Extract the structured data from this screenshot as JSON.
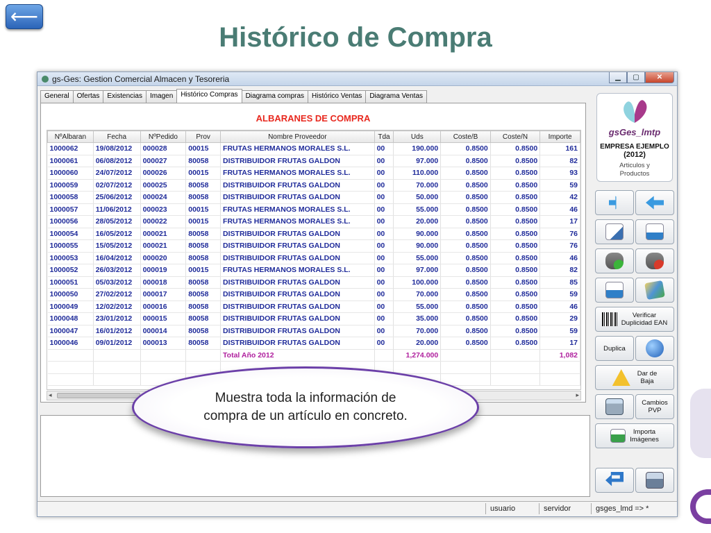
{
  "slide": {
    "title": "Histórico de Compra",
    "back_label": "⟵"
  },
  "window": {
    "title": "gs-Ges: Gestion Comercial Almacen y Tesoreria"
  },
  "tabs": [
    "General",
    "Ofertas",
    "Existencias",
    "Imagen",
    "Histórico Compras",
    "Diagrama compras",
    "Histórico Ventas",
    "Diagrama Ventas"
  ],
  "grid": {
    "title": "ALBARANES DE COMPRA",
    "columns": [
      "NºAlbaran",
      "Fecha",
      "NºPedido",
      "Prov",
      "Nombre Proveedor",
      "Tda",
      "Uds",
      "Coste/B",
      "Coste/N",
      "Importe"
    ],
    "rows": [
      [
        "1000062",
        "19/08/2012",
        "000028",
        "00015",
        "FRUTAS HERMANOS MORALES S.L.",
        "00",
        "190.000",
        "0.8500",
        "0.8500",
        "161"
      ],
      [
        "1000061",
        "06/08/2012",
        "000027",
        "80058",
        "DISTRIBUIDOR FRUTAS GALDON",
        "00",
        "97.000",
        "0.8500",
        "0.8500",
        "82"
      ],
      [
        "1000060",
        "24/07/2012",
        "000026",
        "00015",
        "FRUTAS HERMANOS MORALES S.L.",
        "00",
        "110.000",
        "0.8500",
        "0.8500",
        "93"
      ],
      [
        "1000059",
        "02/07/2012",
        "000025",
        "80058",
        "DISTRIBUIDOR FRUTAS GALDON",
        "00",
        "70.000",
        "0.8500",
        "0.8500",
        "59"
      ],
      [
        "1000058",
        "25/06/2012",
        "000024",
        "80058",
        "DISTRIBUIDOR FRUTAS GALDON",
        "00",
        "50.000",
        "0.8500",
        "0.8500",
        "42"
      ],
      [
        "1000057",
        "11/06/2012",
        "000023",
        "00015",
        "FRUTAS HERMANOS MORALES S.L.",
        "00",
        "55.000",
        "0.8500",
        "0.8500",
        "46"
      ],
      [
        "1000056",
        "28/05/2012",
        "000022",
        "00015",
        "FRUTAS HERMANOS MORALES S.L.",
        "00",
        "20.000",
        "0.8500",
        "0.8500",
        "17"
      ],
      [
        "1000054",
        "16/05/2012",
        "000021",
        "80058",
        "DISTRIBUIDOR FRUTAS GALDON",
        "00",
        "90.000",
        "0.8500",
        "0.8500",
        "76"
      ],
      [
        "1000055",
        "15/05/2012",
        "000021",
        "80058",
        "DISTRIBUIDOR FRUTAS GALDON",
        "00",
        "90.000",
        "0.8500",
        "0.8500",
        "76"
      ],
      [
        "1000053",
        "16/04/2012",
        "000020",
        "80058",
        "DISTRIBUIDOR FRUTAS GALDON",
        "00",
        "55.000",
        "0.8500",
        "0.8500",
        "46"
      ],
      [
        "1000052",
        "26/03/2012",
        "000019",
        "00015",
        "FRUTAS HERMANOS MORALES S.L.",
        "00",
        "97.000",
        "0.8500",
        "0.8500",
        "82"
      ],
      [
        "1000051",
        "05/03/2012",
        "000018",
        "80058",
        "DISTRIBUIDOR FRUTAS GALDON",
        "00",
        "100.000",
        "0.8500",
        "0.8500",
        "85"
      ],
      [
        "1000050",
        "27/02/2012",
        "000017",
        "80058",
        "DISTRIBUIDOR FRUTAS GALDON",
        "00",
        "70.000",
        "0.8500",
        "0.8500",
        "59"
      ],
      [
        "1000049",
        "12/02/2012",
        "000016",
        "80058",
        "DISTRIBUIDOR FRUTAS GALDON",
        "00",
        "55.000",
        "0.8500",
        "0.8500",
        "46"
      ],
      [
        "1000048",
        "23/01/2012",
        "000015",
        "80058",
        "DISTRIBUIDOR FRUTAS GALDON",
        "00",
        "35.000",
        "0.8500",
        "0.8500",
        "29"
      ],
      [
        "1000047",
        "16/01/2012",
        "000014",
        "80058",
        "DISTRIBUIDOR FRUTAS GALDON",
        "00",
        "70.000",
        "0.8500",
        "0.8500",
        "59"
      ],
      [
        "1000046",
        "09/01/2012",
        "000013",
        "80058",
        "DISTRIBUIDOR FRUTAS GALDON",
        "00",
        "20.000",
        "0.8500",
        "0.8500",
        "17"
      ]
    ],
    "total": {
      "label": "Total Año 2012",
      "uds": "1,274.000",
      "importe": "1,082"
    }
  },
  "sidebar": {
    "logo_name": "gsGes_lmtp",
    "company": "EMPRESA EJEMPLO",
    "year": "(2012)",
    "module_line1": "Articulos y",
    "module_line2": "Productos",
    "verificar_line1": "Verificar",
    "verificar_line2": "Duplicidad EAN",
    "duplica": "Duplica",
    "dar_baja_line1": "Dar de",
    "dar_baja_line2": "Baja",
    "cambios_line1": "Cambios",
    "cambios_line2": "PVP",
    "importa_line1": "Importa",
    "importa_line2": "Imágenes"
  },
  "status": {
    "user": "usuario",
    "server": "servidor",
    "db": "gsges_lmd => *"
  },
  "callout": {
    "line1": "Muestra toda la información de",
    "line2": "compra de un artículo en concreto."
  }
}
